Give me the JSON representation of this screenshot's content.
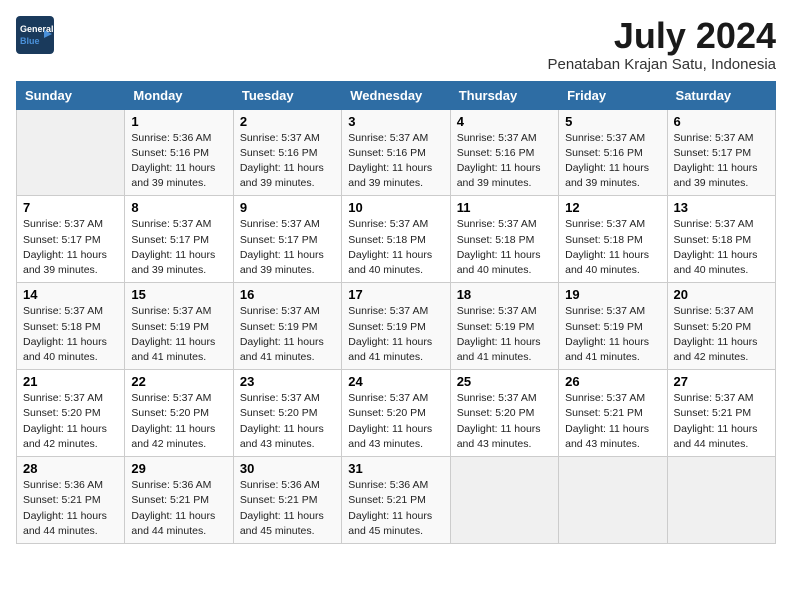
{
  "logo": {
    "general": "General",
    "blue": "Blue"
  },
  "title": "July 2024",
  "location": "Penataban Krajan Satu, Indonesia",
  "days_of_week": [
    "Sunday",
    "Monday",
    "Tuesday",
    "Wednesday",
    "Thursday",
    "Friday",
    "Saturday"
  ],
  "weeks": [
    [
      {
        "day": "",
        "info": ""
      },
      {
        "day": "1",
        "info": "Sunrise: 5:36 AM\nSunset: 5:16 PM\nDaylight: 11 hours\nand 39 minutes."
      },
      {
        "day": "2",
        "info": "Sunrise: 5:37 AM\nSunset: 5:16 PM\nDaylight: 11 hours\nand 39 minutes."
      },
      {
        "day": "3",
        "info": "Sunrise: 5:37 AM\nSunset: 5:16 PM\nDaylight: 11 hours\nand 39 minutes."
      },
      {
        "day": "4",
        "info": "Sunrise: 5:37 AM\nSunset: 5:16 PM\nDaylight: 11 hours\nand 39 minutes."
      },
      {
        "day": "5",
        "info": "Sunrise: 5:37 AM\nSunset: 5:16 PM\nDaylight: 11 hours\nand 39 minutes."
      },
      {
        "day": "6",
        "info": "Sunrise: 5:37 AM\nSunset: 5:17 PM\nDaylight: 11 hours\nand 39 minutes."
      }
    ],
    [
      {
        "day": "7",
        "info": "Sunrise: 5:37 AM\nSunset: 5:17 PM\nDaylight: 11 hours\nand 39 minutes."
      },
      {
        "day": "8",
        "info": "Sunrise: 5:37 AM\nSunset: 5:17 PM\nDaylight: 11 hours\nand 39 minutes."
      },
      {
        "day": "9",
        "info": "Sunrise: 5:37 AM\nSunset: 5:17 PM\nDaylight: 11 hours\nand 39 minutes."
      },
      {
        "day": "10",
        "info": "Sunrise: 5:37 AM\nSunset: 5:18 PM\nDaylight: 11 hours\nand 40 minutes."
      },
      {
        "day": "11",
        "info": "Sunrise: 5:37 AM\nSunset: 5:18 PM\nDaylight: 11 hours\nand 40 minutes."
      },
      {
        "day": "12",
        "info": "Sunrise: 5:37 AM\nSunset: 5:18 PM\nDaylight: 11 hours\nand 40 minutes."
      },
      {
        "day": "13",
        "info": "Sunrise: 5:37 AM\nSunset: 5:18 PM\nDaylight: 11 hours\nand 40 minutes."
      }
    ],
    [
      {
        "day": "14",
        "info": "Sunrise: 5:37 AM\nSunset: 5:18 PM\nDaylight: 11 hours\nand 40 minutes."
      },
      {
        "day": "15",
        "info": "Sunrise: 5:37 AM\nSunset: 5:19 PM\nDaylight: 11 hours\nand 41 minutes."
      },
      {
        "day": "16",
        "info": "Sunrise: 5:37 AM\nSunset: 5:19 PM\nDaylight: 11 hours\nand 41 minutes."
      },
      {
        "day": "17",
        "info": "Sunrise: 5:37 AM\nSunset: 5:19 PM\nDaylight: 11 hours\nand 41 minutes."
      },
      {
        "day": "18",
        "info": "Sunrise: 5:37 AM\nSunset: 5:19 PM\nDaylight: 11 hours\nand 41 minutes."
      },
      {
        "day": "19",
        "info": "Sunrise: 5:37 AM\nSunset: 5:19 PM\nDaylight: 11 hours\nand 41 minutes."
      },
      {
        "day": "20",
        "info": "Sunrise: 5:37 AM\nSunset: 5:20 PM\nDaylight: 11 hours\nand 42 minutes."
      }
    ],
    [
      {
        "day": "21",
        "info": "Sunrise: 5:37 AM\nSunset: 5:20 PM\nDaylight: 11 hours\nand 42 minutes."
      },
      {
        "day": "22",
        "info": "Sunrise: 5:37 AM\nSunset: 5:20 PM\nDaylight: 11 hours\nand 42 minutes."
      },
      {
        "day": "23",
        "info": "Sunrise: 5:37 AM\nSunset: 5:20 PM\nDaylight: 11 hours\nand 43 minutes."
      },
      {
        "day": "24",
        "info": "Sunrise: 5:37 AM\nSunset: 5:20 PM\nDaylight: 11 hours\nand 43 minutes."
      },
      {
        "day": "25",
        "info": "Sunrise: 5:37 AM\nSunset: 5:20 PM\nDaylight: 11 hours\nand 43 minutes."
      },
      {
        "day": "26",
        "info": "Sunrise: 5:37 AM\nSunset: 5:21 PM\nDaylight: 11 hours\nand 43 minutes."
      },
      {
        "day": "27",
        "info": "Sunrise: 5:37 AM\nSunset: 5:21 PM\nDaylight: 11 hours\nand 44 minutes."
      }
    ],
    [
      {
        "day": "28",
        "info": "Sunrise: 5:36 AM\nSunset: 5:21 PM\nDaylight: 11 hours\nand 44 minutes."
      },
      {
        "day": "29",
        "info": "Sunrise: 5:36 AM\nSunset: 5:21 PM\nDaylight: 11 hours\nand 44 minutes."
      },
      {
        "day": "30",
        "info": "Sunrise: 5:36 AM\nSunset: 5:21 PM\nDaylight: 11 hours\nand 45 minutes."
      },
      {
        "day": "31",
        "info": "Sunrise: 5:36 AM\nSunset: 5:21 PM\nDaylight: 11 hours\nand 45 minutes."
      },
      {
        "day": "",
        "info": ""
      },
      {
        "day": "",
        "info": ""
      },
      {
        "day": "",
        "info": ""
      }
    ]
  ]
}
